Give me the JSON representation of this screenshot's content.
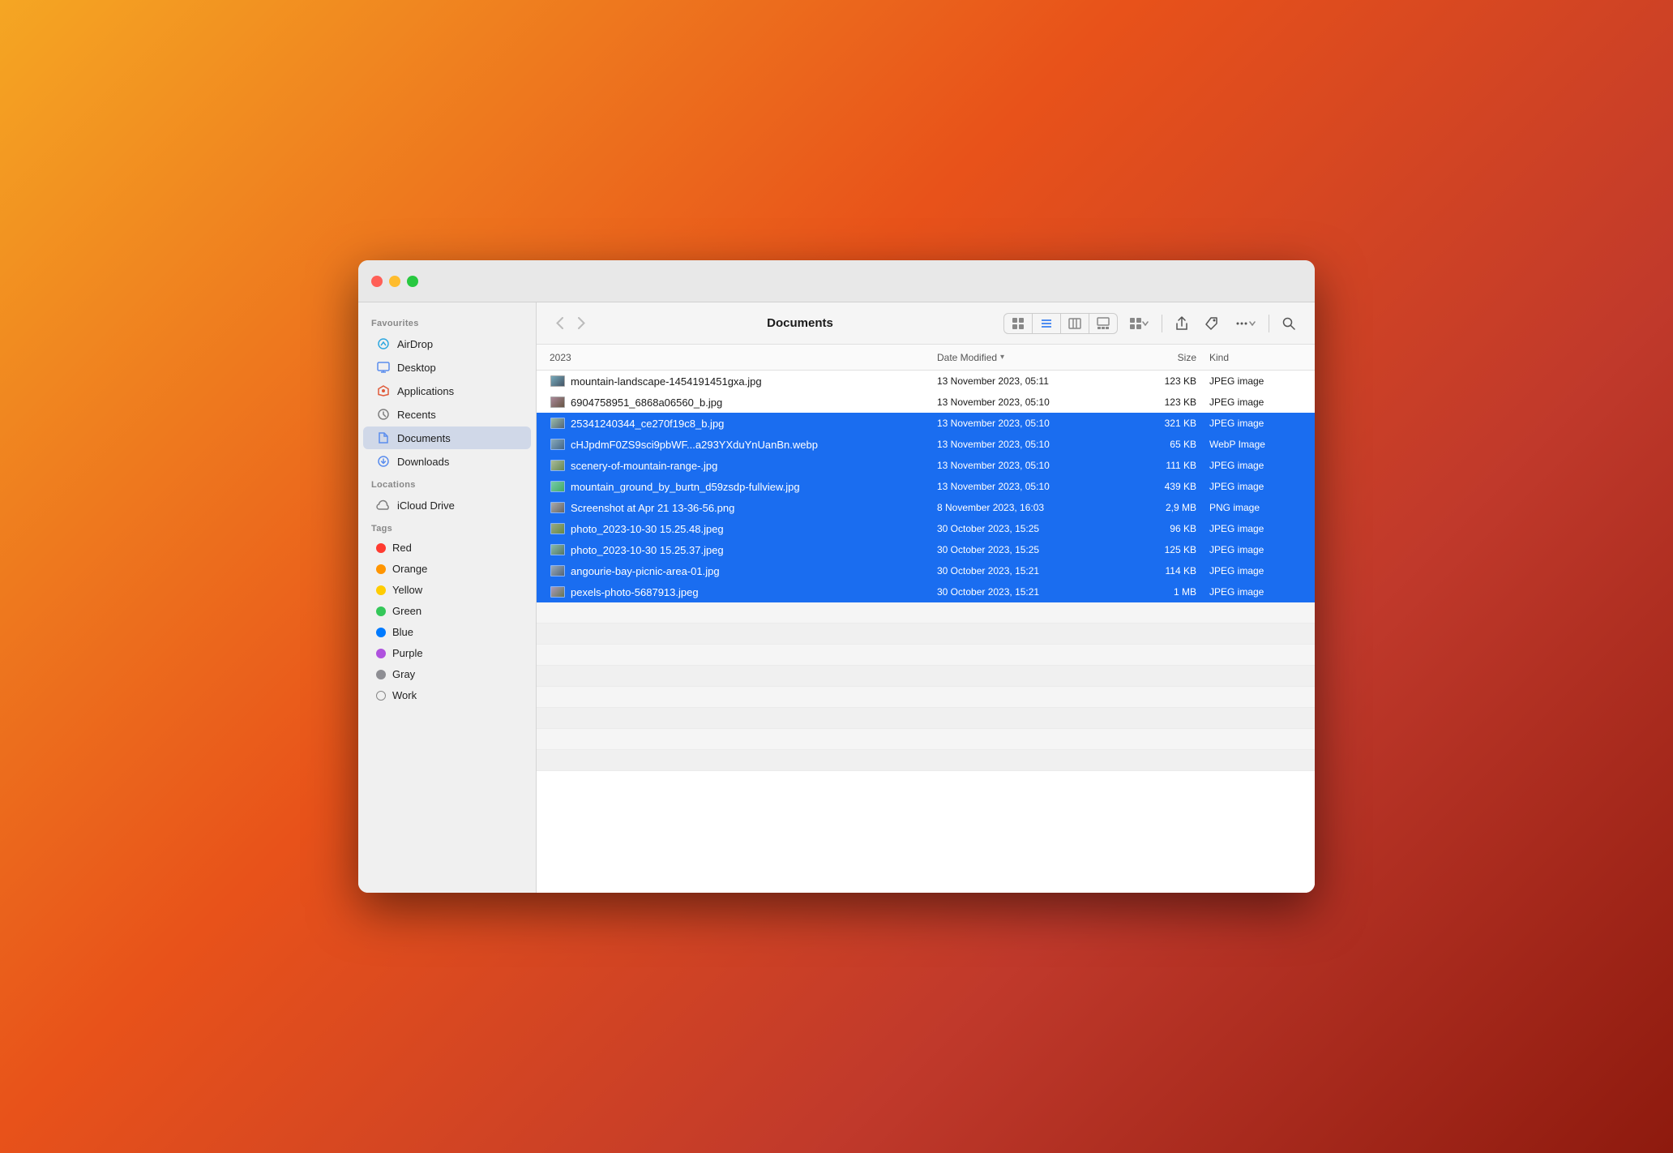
{
  "window": {
    "title": "Documents"
  },
  "toolbar": {
    "back_label": "‹",
    "forward_label": "›",
    "title": "Documents",
    "view_icon_grid": "⊞",
    "view_icon_list": "≡",
    "view_icon_columns": "⊟",
    "view_icon_gallery": "⊡",
    "view_icon_group": "⊞",
    "share_label": "↑",
    "tag_label": "◇",
    "more_label": "···",
    "search_label": "⌕"
  },
  "columns": {
    "name": "2023",
    "date_modified": "Date Modified",
    "size": "Size",
    "kind": "Kind"
  },
  "files": [
    {
      "name": "mountain-landscape-1454191451gxa.jpg",
      "date": "13 November 2023, 05:11",
      "size": "123 KB",
      "kind": "JPEG image",
      "selected": false
    },
    {
      "name": "6904758951_6868a06560_b.jpg",
      "date": "13 November 2023, 05:10",
      "size": "123 KB",
      "kind": "JPEG image",
      "selected": false
    },
    {
      "name": "25341240344_ce270f19c8_b.jpg",
      "date": "13 November 2023, 05:10",
      "size": "321 KB",
      "kind": "JPEG image",
      "selected": true
    },
    {
      "name": "cHJpdmF0ZS9sci9pbWF...a293YXduYnUanBn.webp",
      "date": "13 November 2023, 05:10",
      "size": "65 KB",
      "kind": "WebP Image",
      "selected": true
    },
    {
      "name": "scenery-of-mountain-range-.jpg",
      "date": "13 November 2023, 05:10",
      "size": "111 KB",
      "kind": "JPEG image",
      "selected": true
    },
    {
      "name": "mountain_ground_by_burtn_d59zsdp-fullview.jpg",
      "date": "13 November 2023, 05:10",
      "size": "439 KB",
      "kind": "JPEG image",
      "selected": true
    },
    {
      "name": "Screenshot at Apr 21 13-36-56.png",
      "date": "8 November 2023, 16:03",
      "size": "2,9 MB",
      "kind": "PNG image",
      "selected": true
    },
    {
      "name": "photo_2023-10-30 15.25.48.jpeg",
      "date": "30 October 2023, 15:25",
      "size": "96 KB",
      "kind": "JPEG image",
      "selected": true
    },
    {
      "name": "photo_2023-10-30 15.25.37.jpeg",
      "date": "30 October 2023, 15:25",
      "size": "125 KB",
      "kind": "JPEG image",
      "selected": true
    },
    {
      "name": "angourie-bay-picnic-area-01.jpg",
      "date": "30 October 2023, 15:21",
      "size": "114 KB",
      "kind": "JPEG image",
      "selected": true
    },
    {
      "name": "pexels-photo-5687913.jpeg",
      "date": "30 October 2023, 15:21",
      "size": "1 MB",
      "kind": "JPEG image",
      "selected": true
    }
  ],
  "sidebar": {
    "favourites_label": "Favourites",
    "locations_label": "Locations",
    "tags_label": "Tags",
    "favourites": [
      {
        "id": "airdrop",
        "label": "AirDrop",
        "icon_color": "#2fa8e0"
      },
      {
        "id": "desktop",
        "label": "Desktop",
        "icon_color": "#5a8dee"
      },
      {
        "id": "applications",
        "label": "Applications",
        "icon_color": "#e05a3a"
      },
      {
        "id": "recents",
        "label": "Recents",
        "icon_color": "#7e7e7e"
      },
      {
        "id": "documents",
        "label": "Documents",
        "icon_color": "#5a8dee"
      },
      {
        "id": "downloads",
        "label": "Downloads",
        "icon_color": "#5a8dee"
      }
    ],
    "locations": [
      {
        "id": "icloud",
        "label": "iCloud Drive"
      }
    ],
    "tags": [
      {
        "id": "red",
        "label": "Red",
        "color": "#ff3b30"
      },
      {
        "id": "orange",
        "label": "Orange",
        "color": "#ff9500"
      },
      {
        "id": "yellow",
        "label": "Yellow",
        "color": "#ffcc00"
      },
      {
        "id": "green",
        "label": "Green",
        "color": "#34c759"
      },
      {
        "id": "blue",
        "label": "Blue",
        "color": "#007aff"
      },
      {
        "id": "purple",
        "label": "Purple",
        "color": "#af52de"
      },
      {
        "id": "gray",
        "label": "Gray",
        "color": "#8e8e93"
      },
      {
        "id": "work",
        "label": "Work",
        "outline": true
      }
    ]
  }
}
